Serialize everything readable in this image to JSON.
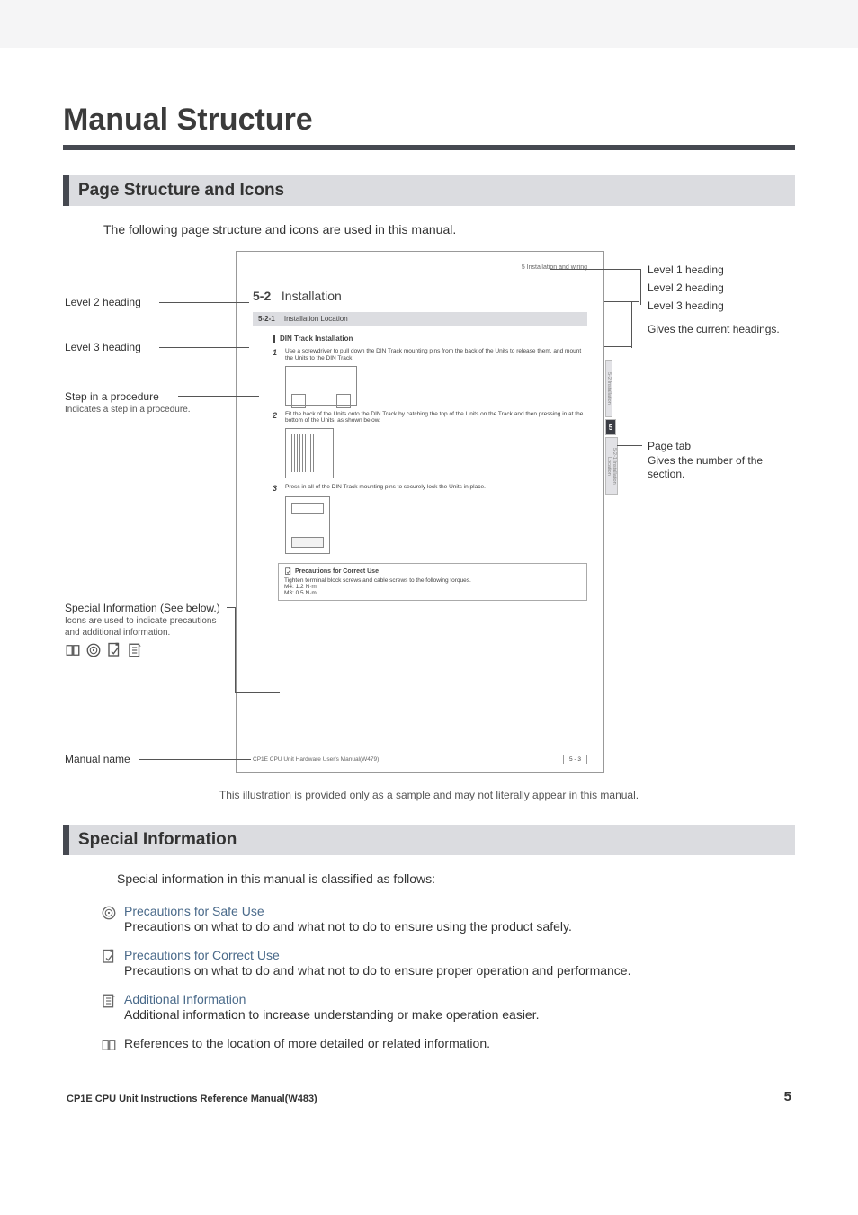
{
  "h1": "Manual Structure",
  "sections": {
    "page_structure": {
      "title": "Page Structure and Icons",
      "intro": "The following page structure and icons are used in this manual."
    },
    "special_info": {
      "title": "Special Information",
      "intro": "Special information in this manual is classified as follows:"
    }
  },
  "callouts": {
    "l2": "Level 2 heading",
    "l3": "Level 3 heading",
    "step_title": "Step in a procedure",
    "step_sub": "Indicates a step in a procedure.",
    "sp_title": "Special Information (See below.)",
    "sp_sub": "Icons are used to indicate precautions and additional information.",
    "manual": "Manual name",
    "r_l1": "Level 1 heading",
    "r_l2": "Level 2 heading",
    "r_l3": "Level 3 heading",
    "r_gives": "Gives the current headings.",
    "r_tab": "Page tab",
    "r_tab_sub": "Gives the number of the section."
  },
  "sample": {
    "topright": "5 Installation and wiring",
    "h2_num": "5-2",
    "h2_title": "Installation",
    "h3_num": "5-2-1",
    "h3_title": "Installation Location",
    "h4": "DIN Track Installation",
    "steps": {
      "s1": "Use a screwdriver to pull down the DIN Track mounting pins from the back of the Units to release them, and mount the Units to the DIN Track.",
      "s2": "Fit the back of the Units onto the DIN Track by catching the top of the Units on the Track and then pressing in at the bottom of the Units, as shown below.",
      "s3": "Press in all of the DIN Track mounting pins to securely lock the Units in place."
    },
    "prec_title": "Precautions for Correct Use",
    "prec_body": "Tighten terminal block screws and cable screws to the following torques.\n  M4: 1.2 N·m\n  M3: 0.5 N·m",
    "footer_name": "CP1E CPU Unit Hardware User's Manual(W479)",
    "pagen": "5 - 3",
    "tab_a": "5-2  Installation",
    "tab_num": "5",
    "tab_b": "5-2-1  Installation Location"
  },
  "caption": "This illustration is provided only as a sample and may not literally appear in this manual.",
  "si_items": [
    {
      "title": "Precautions for Safe Use",
      "desc": "Precautions on what to do and what not to do to ensure using the product safely."
    },
    {
      "title": "Precautions for Correct Use",
      "desc": "Precautions on what to do and what not to do to ensure proper operation and performance."
    },
    {
      "title": "Additional Information",
      "desc": "Additional information to increase understanding or make operation easier."
    },
    {
      "title": "",
      "desc": "References to the location of more detailed or related information."
    }
  ],
  "footer": {
    "left": "CP1E CPU Unit Instructions Reference Manual(W483)",
    "right": "5"
  }
}
